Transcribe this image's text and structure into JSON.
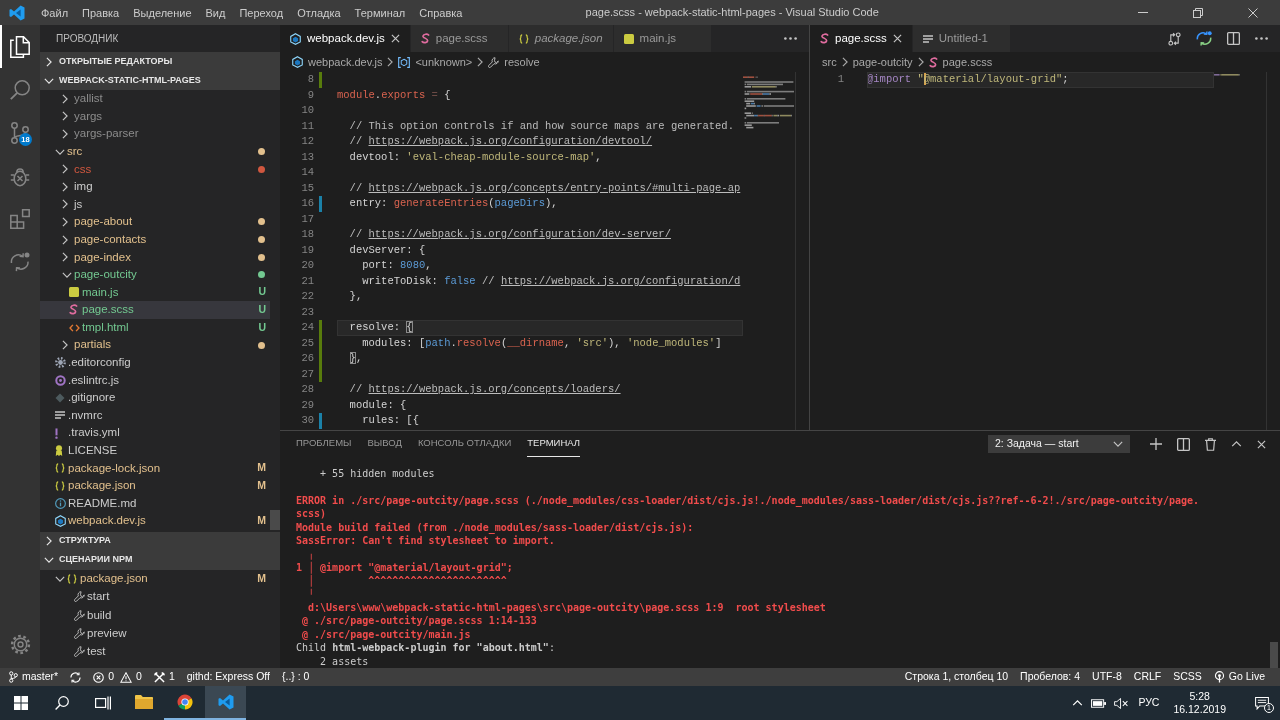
{
  "title_bar": {
    "menu": [
      "Файл",
      "Правка",
      "Выделение",
      "Вид",
      "Переход",
      "Отладка",
      "Терминал",
      "Справка"
    ],
    "title": "page.scss - webpack-static-html-pages - Visual Studio Code",
    "controls": [
      {
        "kind": "minimize"
      },
      {
        "kind": "restore"
      },
      {
        "kind": "close"
      }
    ]
  },
  "activity_bar": {
    "items": [
      {
        "kind": "files",
        "selected": true
      },
      {
        "kind": "search",
        "selected": false
      },
      {
        "kind": "source_control",
        "selected": false,
        "badge": "18"
      },
      {
        "kind": "debug",
        "selected": false
      },
      {
        "kind": "extensions",
        "selected": false
      },
      {
        "kind": "live_share",
        "selected": false
      }
    ],
    "bottom": [
      {
        "kind": "settings"
      }
    ]
  },
  "sidebar": {
    "title": "ПРОВОДНИК",
    "sections": [
      {
        "title": "ОТКРЫТЫЕ РЕДАКТОРЫ",
        "expanded": false
      },
      {
        "title": "WEBPACK-STATIC-HTML-PAGES",
        "expanded": true,
        "tree": [
          {
            "children": [
              {
                "label": "yallist",
                "kind": "folder",
                "expanded": false,
                "color": "#8c8c8c",
                "dot": false,
                "selected": false
              },
              {
                "label": "yargs",
                "kind": "folder",
                "expanded": false,
                "color": "#8c8c8c",
                "dot": false,
                "selected": false
              },
              {
                "label": "yargs-parser",
                "kind": "folder",
                "expanded": false,
                "color": "#8c8c8c",
                "dot": false,
                "selected": false
              }
            ]
          },
          {
            "label": "src",
            "kind": "folder",
            "expanded": true,
            "color": "#e2c08d",
            "dot": true,
            "selected": false,
            "children": [
              {
                "label": "css",
                "kind": "folder",
                "expanded": false,
                "color": "#d0573f",
                "dot": true,
                "selected": false
              },
              {
                "label": "img",
                "kind": "folder",
                "expanded": false,
                "color": "#cccccc",
                "dot": false,
                "selected": false
              },
              {
                "label": "js",
                "kind": "folder",
                "expanded": false,
                "color": "#cccccc",
                "dot": false,
                "selected": false
              },
              {
                "label": "page-about",
                "kind": "folder",
                "expanded": false,
                "color": "#e2c08d",
                "dot": true,
                "selected": false
              },
              {
                "label": "page-contacts",
                "kind": "folder",
                "expanded": false,
                "color": "#e2c08d",
                "dot": true,
                "selected": false
              },
              {
                "label": "page-index",
                "kind": "folder",
                "expanded": false,
                "color": "#e2c08d",
                "dot": true,
                "selected": false
              },
              {
                "label": "page-outcity",
                "kind": "folder",
                "expanded": true,
                "color": "#73c991",
                "dot": true,
                "selected": false,
                "children": [
                  {
                    "label": "main.js",
                    "kind": "js",
                    "color": "#73c991",
                    "badge": "U",
                    "selected": false
                  },
                  {
                    "label": "page.scss",
                    "kind": "scss",
                    "color": "#73c991",
                    "badge": "U",
                    "selected": true
                  },
                  {
                    "label": "tmpl.html",
                    "kind": "html",
                    "color": "#73c991",
                    "badge": "U",
                    "selected": false
                  }
                ]
              },
              {
                "label": "partials",
                "kind": "folder",
                "expanded": false,
                "color": "#e2c08d",
                "dot": true,
                "selected": false
              }
            ]
          },
          {
            "label": ".editorconfig",
            "kind": "config",
            "color": "#cccccc",
            "selected": false
          },
          {
            "label": ".eslintrc.js",
            "kind": "eslint",
            "color": "#cccccc",
            "selected": false
          },
          {
            "label": ".gitignore",
            "kind": "git",
            "color": "#cccccc",
            "selected": false
          },
          {
            "label": ".nvmrc",
            "kind": "text",
            "color": "#cccccc",
            "selected": false
          },
          {
            "label": ".travis.yml",
            "kind": "yaml",
            "color": "#cccccc",
            "selected": false
          },
          {
            "label": "LICENSE",
            "kind": "license",
            "color": "#cccccc",
            "selected": false
          },
          {
            "label": "package-lock.json",
            "kind": "json",
            "color": "#e2c08d",
            "badge": "M",
            "selected": false
          },
          {
            "label": "package.json",
            "kind": "json",
            "color": "#e2c08d",
            "badge": "M",
            "selected": false
          },
          {
            "label": "README.md",
            "kind": "info",
            "color": "#cccccc",
            "selected": false
          },
          {
            "label": "webpack.dev.js",
            "kind": "webpack",
            "color": "#e2c08d",
            "badge": "M",
            "selected": false
          }
        ]
      },
      {
        "title": "СТРУКТУРА",
        "expanded": false
      },
      {
        "title": "СЦЕНАРИИ NPM",
        "expanded": true,
        "tree": [
          {
            "label": "package.json",
            "kind": "json",
            "expanded": true,
            "color": "#e2c08d",
            "badge": "M",
            "selected": false,
            "children": [
              {
                "label": "start",
                "kind": "script",
                "color": "#cccccc",
                "selected": false
              },
              {
                "label": "build",
                "kind": "script",
                "color": "#cccccc",
                "selected": false
              },
              {
                "label": "preview",
                "kind": "script",
                "color": "#cccccc",
                "selected": false
              },
              {
                "label": "test",
                "kind": "script",
                "color": "#cccccc",
                "selected": false
              }
            ]
          }
        ]
      }
    ]
  },
  "editor_groups": [
    {
      "tabs": [
        {
          "label": "webpack.dev.js",
          "kind": "webpack",
          "selected": true,
          "preview": false
        },
        {
          "label": "page.scss",
          "kind": "scss",
          "selected": false,
          "preview": false
        },
        {
          "label": "package.json",
          "kind": "json",
          "selected": false,
          "preview": true
        },
        {
          "label": "main.js",
          "kind": "js",
          "selected": false,
          "preview": false
        }
      ],
      "actions": [
        {
          "kind": "more"
        }
      ],
      "breadcrumbs": [
        {
          "label": "webpack.dev.js",
          "kind": "webpack"
        },
        {
          "label": "<unknown>",
          "kind": "module"
        },
        {
          "label": "resolve",
          "kind": "property"
        }
      ],
      "lines": [
        {
          "number": "8",
          "color": "#587c0c"
        },
        {
          "number": "9",
          "tokens": [
            {
              "text": "module",
              "kind": "name"
            },
            {
              "text": ".",
              "kind": "plain"
            },
            {
              "text": "exports",
              "kind": "name"
            },
            {
              "text": " = ",
              "kind": "operator"
            },
            {
              "text": "{",
              "kind": "plain"
            }
          ]
        },
        {
          "number": "10"
        },
        {
          "number": "11",
          "tokens": [
            {
              "text": "  // This option controls if and how source maps are generated.",
              "kind": "comment"
            }
          ]
        },
        {
          "number": "12",
          "tokens": [
            {
              "text": "  // ",
              "kind": "comment"
            },
            {
              "text": "https://webpack.js.org/configuration/devtool/",
              "kind": "link"
            }
          ]
        },
        {
          "number": "13",
          "tokens": [
            {
              "text": "  devtool: ",
              "kind": "plain"
            },
            {
              "text": "'eval-cheap-module-source-map'",
              "kind": "string"
            },
            {
              "text": ",",
              "kind": "plain"
            }
          ]
        },
        {
          "number": "14"
        },
        {
          "number": "15",
          "tokens": [
            {
              "text": "  // ",
              "kind": "comment"
            },
            {
              "text": "https://webpack.js.org/concepts/entry-points/#multi-page-ap",
              "kind": "link"
            }
          ]
        },
        {
          "number": "16",
          "color": "#1b81a8",
          "tokens": [
            {
              "text": "  entry: ",
              "kind": "plain"
            },
            {
              "text": "generateEntries",
              "kind": "name"
            },
            {
              "text": "(",
              "kind": "plain"
            },
            {
              "text": "pageDirs",
              "kind": "value"
            },
            {
              "text": "),",
              "kind": "plain"
            }
          ]
        },
        {
          "number": "17"
        },
        {
          "number": "18",
          "tokens": [
            {
              "text": "  // ",
              "kind": "comment"
            },
            {
              "text": "https://webpack.js.org/configuration/dev-server/",
              "kind": "link"
            }
          ]
        },
        {
          "number": "19",
          "tokens": [
            {
              "text": "  devServer: {",
              "kind": "plain"
            }
          ]
        },
        {
          "number": "20",
          "tokens": [
            {
              "text": "    port: ",
              "kind": "plain"
            },
            {
              "text": "8080",
              "kind": "value"
            },
            {
              "text": ",",
              "kind": "plain"
            }
          ]
        },
        {
          "number": "21",
          "tokens": [
            {
              "text": "    writeToDisk: ",
              "kind": "plain"
            },
            {
              "text": "false",
              "kind": "value"
            },
            {
              "text": " // ",
              "kind": "comment"
            },
            {
              "text": "https://webpack.js.org/configuration/d",
              "kind": "link"
            }
          ]
        },
        {
          "number": "22",
          "tokens": [
            {
              "text": "  },",
              "kind": "plain"
            }
          ]
        },
        {
          "number": "23"
        },
        {
          "number": "24",
          "color": "#587c0c",
          "current": true,
          "tokens": [
            {
              "text": "  resolve: ",
              "kind": "plain"
            },
            {
              "text": "{",
              "kind": "bracket"
            }
          ]
        },
        {
          "number": "25",
          "color": "#587c0c",
          "tokens": [
            {
              "text": "    modules: [",
              "kind": "plain"
            },
            {
              "text": "path",
              "kind": "value"
            },
            {
              "text": ".",
              "kind": "plain"
            },
            {
              "text": "resolve",
              "kind": "name"
            },
            {
              "text": "(",
              "kind": "plain"
            },
            {
              "text": "__dirname",
              "kind": "name"
            },
            {
              "text": ", ",
              "kind": "plain"
            },
            {
              "text": "'src'",
              "kind": "string"
            },
            {
              "text": "), ",
              "kind": "plain"
            },
            {
              "text": "'node_modules'",
              "kind": "string"
            },
            {
              "text": "]",
              "kind": "plain"
            }
          ]
        },
        {
          "number": "26",
          "color": "#587c0c",
          "tokens": [
            {
              "text": "  }",
              "kind": "bracket"
            },
            {
              "text": ",",
              "kind": "plain"
            }
          ]
        },
        {
          "number": "27",
          "color": "#587c0c"
        },
        {
          "number": "28",
          "tokens": [
            {
              "text": "  // ",
              "kind": "comment"
            },
            {
              "text": "https://webpack.js.org/concepts/loaders/",
              "kind": "link"
            }
          ]
        },
        {
          "number": "29",
          "tokens": [
            {
              "text": "  module: {",
              "kind": "plain"
            }
          ]
        },
        {
          "number": "30",
          "color": "#1b81a8",
          "tokens": [
            {
              "text": "    rules: [{",
              "kind": "plain"
            }
          ]
        }
      ]
    },
    {
      "tabs": [
        {
          "label": "page.scss",
          "kind": "scss",
          "selected": true,
          "preview": false
        },
        {
          "label": "Untitled-1",
          "kind": "text",
          "selected": false,
          "preview": false
        }
      ],
      "actions": [
        {
          "kind": "compare"
        },
        {
          "kind": "live_share"
        },
        {
          "kind": "split"
        },
        {
          "kind": "more"
        }
      ],
      "breadcrumbs": [
        {
          "label": "src",
          "kind": "folder"
        },
        {
          "label": "page-outcity",
          "kind": "folder"
        },
        {
          "label": "page.scss",
          "kind": "scss"
        }
      ],
      "lines": [
        {
          "number": "1",
          "current": true,
          "tokens": [
            {
              "text": "@import",
              "kind": "at_rule"
            },
            {
              "text": " \"",
              "kind": "string"
            },
            {
              "kind": "cursor"
            },
            {
              "text": "@material/layout-grid\"",
              "kind": "string"
            },
            {
              "text": ";",
              "kind": "plain"
            }
          ]
        }
      ]
    }
  ],
  "panel": {
    "tabs": [
      {
        "label": "ПРОБЛЕМЫ",
        "selected": false
      },
      {
        "label": "ВЫВОД",
        "selected": false
      },
      {
        "label": "КОНСОЛЬ ОТЛАДКИ",
        "selected": false
      },
      {
        "label": "ТЕРМИНАЛ",
        "selected": true
      }
    ],
    "terminal_select": {
      "value": "2: Задача — start"
    },
    "actions": [
      {
        "kind": "add"
      },
      {
        "kind": "split"
      },
      {
        "kind": "delete"
      },
      {
        "kind": "maximize"
      },
      {
        "kind": "close"
      }
    ],
    "terminal": {
      "blocks": [
        {
          "lines": [
            {
              "text": "    + 55 hidden modules",
              "kind": "plain"
            }
          ]
        },
        {
          "lines": [
            {
              "text": "ERROR in ./src/page-outcity/page.scss (./node_modules/css-loader/dist/cjs.js!./node_modules/sass-loader/dist/cjs.js??ref--6-2!./src/page-outcity/page.",
              "kind": "error"
            },
            {
              "text": "scss)",
              "kind": "error"
            },
            {
              "text": "Module build failed (from ./node_modules/sass-loader/dist/cjs.js):",
              "kind": "error"
            },
            {
              "text": "SassError: Can't find stylesheet to import.",
              "kind": "error"
            },
            {
              "text": "  ╷",
              "kind": "error"
            },
            {
              "text": "1 │ @import \"@material/layout-grid\";",
              "kind": "error"
            },
            {
              "text": "  │         ^^^^^^^^^^^^^^^^^^^^^^^",
              "kind": "error"
            },
            {
              "text": "  ╵",
              "kind": "error"
            },
            {
              "text": "  d:\\Users\\www\\webpack-static-html-pages\\src\\page-outcity\\page.scss 1:9  root stylesheet",
              "kind": "error"
            },
            {
              "text": " @ ./src/page-outcity/page.scss 1:14-133",
              "kind": "error"
            },
            {
              "text": " @ ./src/page-outcity/main.js",
              "kind": "error"
            },
            {
              "text": "Child **html-webpack-plugin for \"about.html\"**:",
              "kind": "plain"
            },
            {
              "text": "    2 assets",
              "kind": "plain"
            }
          ]
        }
      ]
    }
  },
  "status_bar": {
    "left": [
      {
        "kind": "branch",
        "text": "master*"
      },
      {
        "kind": "sync"
      },
      {
        "kind": "problems",
        "errors": "0",
        "warnings": "0"
      },
      {
        "kind": "tasks",
        "text": "1"
      },
      {
        "kind": "text",
        "text": "githd: Express Off"
      },
      {
        "kind": "text",
        "text": "{..} : 0"
      }
    ],
    "right": [
      {
        "kind": "text",
        "text": "Строка 1, столбец 10"
      },
      {
        "kind": "text",
        "text": "Пробелов: 4"
      },
      {
        "kind": "text",
        "text": "UTF-8"
      },
      {
        "kind": "text",
        "text": "CRLF"
      },
      {
        "kind": "text",
        "text": "SCSS"
      },
      {
        "kind": "broadcast",
        "text": "Go Live"
      }
    ]
  },
  "taskbar": {
    "buttons": [
      {
        "kind": "start"
      },
      {
        "kind": "search"
      },
      {
        "kind": "task_view"
      }
    ],
    "apps": [
      {
        "kind": "file_explorer",
        "running": false,
        "selected": false
      },
      {
        "kind": "chrome",
        "running": true,
        "selected": false
      },
      {
        "kind": "vscode",
        "running": true,
        "selected": true
      }
    ],
    "tray": {
      "icons": [
        {
          "kind": "chevron"
        },
        {
          "kind": "battery"
        },
        {
          "kind": "volume_muted"
        }
      ],
      "language": "РУС",
      "time": "5:28",
      "date": "16.12.2019",
      "notifications": "1"
    }
  }
}
